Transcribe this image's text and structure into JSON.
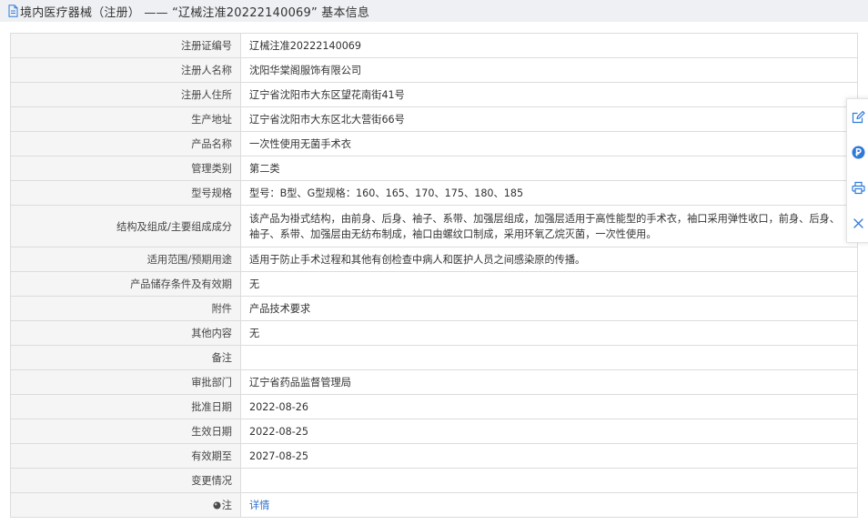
{
  "header": {
    "icon": "document-icon",
    "title": "境内医疗器械（注册） —— “辽械注准20222140069” 基本信息"
  },
  "table": {
    "rows": [
      {
        "label": "注册证编号",
        "value": "辽械注准20222140069"
      },
      {
        "label": "注册人名称",
        "value": "沈阳华棠阁服饰有限公司"
      },
      {
        "label": "注册人住所",
        "value": "辽宁省沈阳市大东区望花南街41号"
      },
      {
        "label": "生产地址",
        "value": "辽宁省沈阳市大东区北大营街66号"
      },
      {
        "label": "产品名称",
        "value": "一次性使用无菌手术衣"
      },
      {
        "label": "管理类别",
        "value": "第二类"
      },
      {
        "label": "型号规格",
        "value": "型号：B型、G型规格：160、165、170、175、180、185"
      },
      {
        "label": "结构及组成/主要组成成分",
        "value": "该产品为褂式结构，由前身、后身、袖子、系带、加强层组成，加强层适用于高性能型的手术衣，袖口采用弹性收口，前身、后身、袖子、系带、加强层由无纺布制成，袖口由螺纹口制成，采用环氧乙烷灭菌，一次性使用。"
      },
      {
        "label": "适用范围/预期用途",
        "value": "适用于防止手术过程和其他有创检查中病人和医护人员之间感染原的传播。"
      },
      {
        "label": "产品储存条件及有效期",
        "value": "无"
      },
      {
        "label": "附件",
        "value": "产品技术要求"
      },
      {
        "label": "其他内容",
        "value": "无"
      },
      {
        "label": "备注",
        "value": ""
      },
      {
        "label": "审批部门",
        "value": "辽宁省药品监督管理局"
      },
      {
        "label": "批准日期",
        "value": "2022-08-26"
      },
      {
        "label": "生效日期",
        "value": "2022-08-25"
      },
      {
        "label": "有效期至",
        "value": "2027-08-25"
      },
      {
        "label": "变更情况",
        "value": ""
      },
      {
        "label": "注",
        "icon": "bullet-icon",
        "value": "详情"
      }
    ]
  },
  "toolbar": {
    "icons": [
      "edit-icon",
      "p-badge-icon",
      "printer-icon",
      "close-icon"
    ]
  },
  "colors": {
    "accent": "#2f7ad9",
    "link": "#2f6fcf",
    "header_bg": "#eef0f3",
    "label_bg": "#f5f5f5",
    "border": "#dcdcdc",
    "text": "#333333"
  }
}
